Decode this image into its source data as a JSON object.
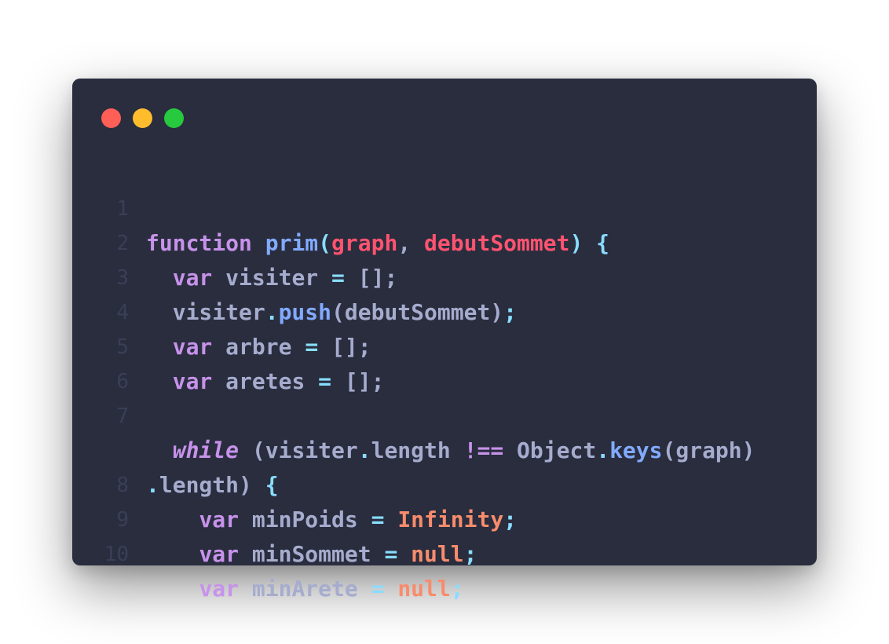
{
  "colors": {
    "background": "#292d3e",
    "keyword": "#c792ea",
    "function": "#82aaff",
    "parameter": "#ff5370",
    "punctuation": "#89ddff",
    "variable": "#a6accd",
    "number_literal": "#f78c6c",
    "line_number": "#3a3f58",
    "window_close": "#ff5f56",
    "window_minimize": "#ffbd2e",
    "window_maximize": "#27c93f"
  },
  "window": {
    "controls": [
      "close",
      "minimize",
      "maximize"
    ]
  },
  "code": {
    "line_numbers": [
      "1",
      "2",
      "3",
      "4",
      "5",
      "6",
      "7",
      "",
      "8",
      "9",
      "10"
    ],
    "lines": [
      [
        "function",
        " ",
        "prim",
        "(",
        "graph",
        ", ",
        "debutSommet",
        ")",
        " {"
      ],
      [
        "  ",
        "var",
        " visiter ",
        "=",
        " [];"
      ],
      [
        "  visiter",
        ".",
        "push",
        "(debutSommet)",
        ";"
      ],
      [
        "  ",
        "var",
        " arbre ",
        "=",
        " [];"
      ],
      [
        "  ",
        "var",
        " aretes ",
        "=",
        " [];"
      ],
      [
        ""
      ],
      [
        "  ",
        "while",
        " (visiter",
        ".",
        "length ",
        "!==",
        " Object",
        ".",
        "keys",
        "(graph)"
      ],
      [
        ".",
        "length) ",
        "{"
      ],
      [
        "    ",
        "var",
        " minPoids ",
        "=",
        " ",
        "Infinity",
        ";"
      ],
      [
        "    ",
        "var",
        " minSommet ",
        "=",
        " ",
        "null",
        ";"
      ],
      [
        "    ",
        "var",
        " minArete ",
        "=",
        " ",
        "null",
        ";"
      ]
    ]
  }
}
